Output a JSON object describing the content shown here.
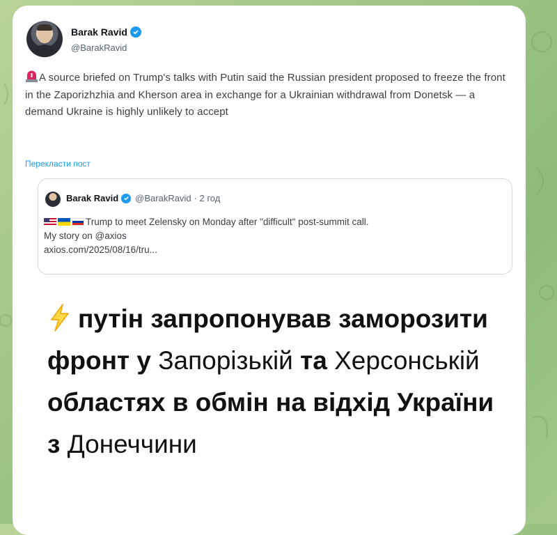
{
  "tweet": {
    "author_name": "Barak Ravid",
    "author_handle": "@BarakRavid",
    "text": "A source briefed on Trump's talks with Putin said the Russian president proposed to freeze the front in the Zaporizhzhia and Kherson area in exchange for a Ukrainian withdrawal from Donetsk — a demand Ukraine is highly unlikely to accept",
    "translate_link": "Перекласти пост"
  },
  "quoted_tweet": {
    "author_name": "Barak Ravid",
    "author_handle": "@BarakRavid",
    "meta": "· 2 год",
    "line1": "Trump to meet Zelensky on Monday after \"difficult\" post-summit call.",
    "line2": "My story on @axios",
    "link": "axios.com/2025/08/16/tru..."
  },
  "headline": {
    "part1": "путін запропонував заморозити фронт у",
    "part2": "Запорізькій",
    "part3": "та",
    "part4": "Херсонській",
    "part5": "областях в обмін на відхід України з",
    "part6": "Донеччини"
  },
  "colors": {
    "accent": "#1d9bf0",
    "background": "#9fc586"
  },
  "icons": [
    "siren-icon",
    "verified-icon",
    "us-flag-icon",
    "ukraine-flag-icon",
    "russia-flag-icon",
    "lightning-icon"
  ]
}
